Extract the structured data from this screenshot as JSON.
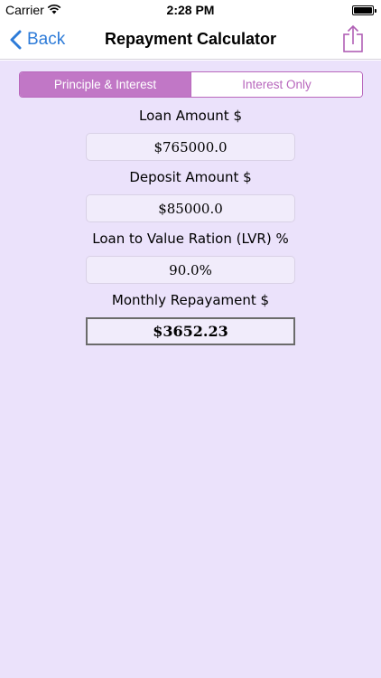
{
  "status_bar": {
    "carrier": "Carrier",
    "time": "2:28 PM"
  },
  "nav": {
    "back_label": "Back",
    "title": "Repayment Calculator",
    "share_icon": "share-icon"
  },
  "segmented_control": {
    "selected": "Principle & Interest",
    "options": [
      "Principle & Interest",
      "Interest Only"
    ]
  },
  "fields": {
    "loan_amount": {
      "label": "Loan Amount $",
      "value": "$765000.0"
    },
    "deposit_amount": {
      "label": "Deposit Amount $",
      "value": "$85000.0"
    },
    "lvr": {
      "label": "Loan to Value Ration (LVR) %",
      "value": "90.0%"
    },
    "monthly_repayment": {
      "label": "Monthly Repayament $",
      "value": "$3652.23"
    }
  },
  "colors": {
    "accent": "#c177c6",
    "link": "#2d7bd8",
    "background": "#ebe2fb"
  }
}
